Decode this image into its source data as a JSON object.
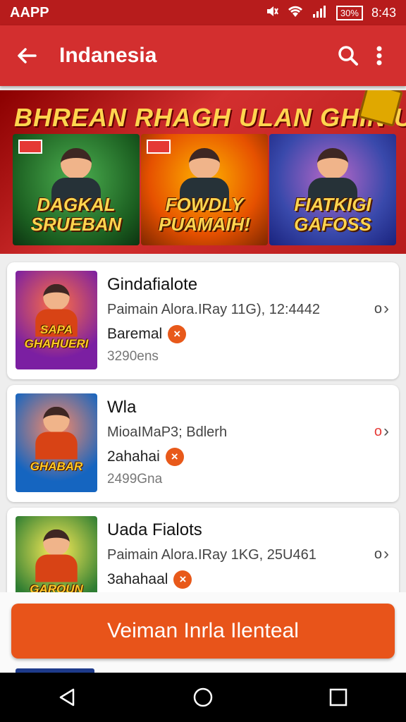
{
  "status_bar": {
    "app_label": "AAPP",
    "time": "8:43",
    "battery": "30%"
  },
  "app_bar": {
    "title": "Indanesia",
    "back_icon": "arrow-left-icon",
    "search_icon": "search-icon",
    "menu_icon": "more-vert-icon"
  },
  "banner": {
    "headline": "BHREAN RHAGH ULAN GHIN UN",
    "tiles": [
      {
        "label": "DAGKAL SRUEBAN"
      },
      {
        "label": "FOWDLY PUAMAIH!"
      },
      {
        "label": "FIATKIGI GAFOSS"
      }
    ]
  },
  "games": [
    {
      "name": "Gindafialote",
      "subtitle": "Paimain Alora.IRay 11G), 12:4442",
      "tag": "Baremal",
      "count": "3290ens",
      "thumb_label": "SAPA GHAHUERI",
      "marker_color": "#444444"
    },
    {
      "name": "Wla",
      "subtitle": "MioaIMaP3; Bdlerh",
      "tag": "2ahahai",
      "count": "2499Gna",
      "thumb_label": "GHABAR",
      "marker_color": "#e53935"
    },
    {
      "name": "Uada Fialots",
      "subtitle": "Paimain Alora.IRay 1KG, 25U461",
      "tag": "3ahahaal",
      "count": "",
      "thumb_label": "GAROUN",
      "marker_color": "#444444"
    }
  ],
  "cta": {
    "label": "Veiman Inrla Ilenteal"
  },
  "nav": {
    "back": "nav-back-icon",
    "home": "nav-home-icon",
    "recents": "nav-recents-icon"
  },
  "colors": {
    "status_bar": "#b71c1c",
    "app_bar": "#d32f2f",
    "accent": "#e8541a"
  }
}
